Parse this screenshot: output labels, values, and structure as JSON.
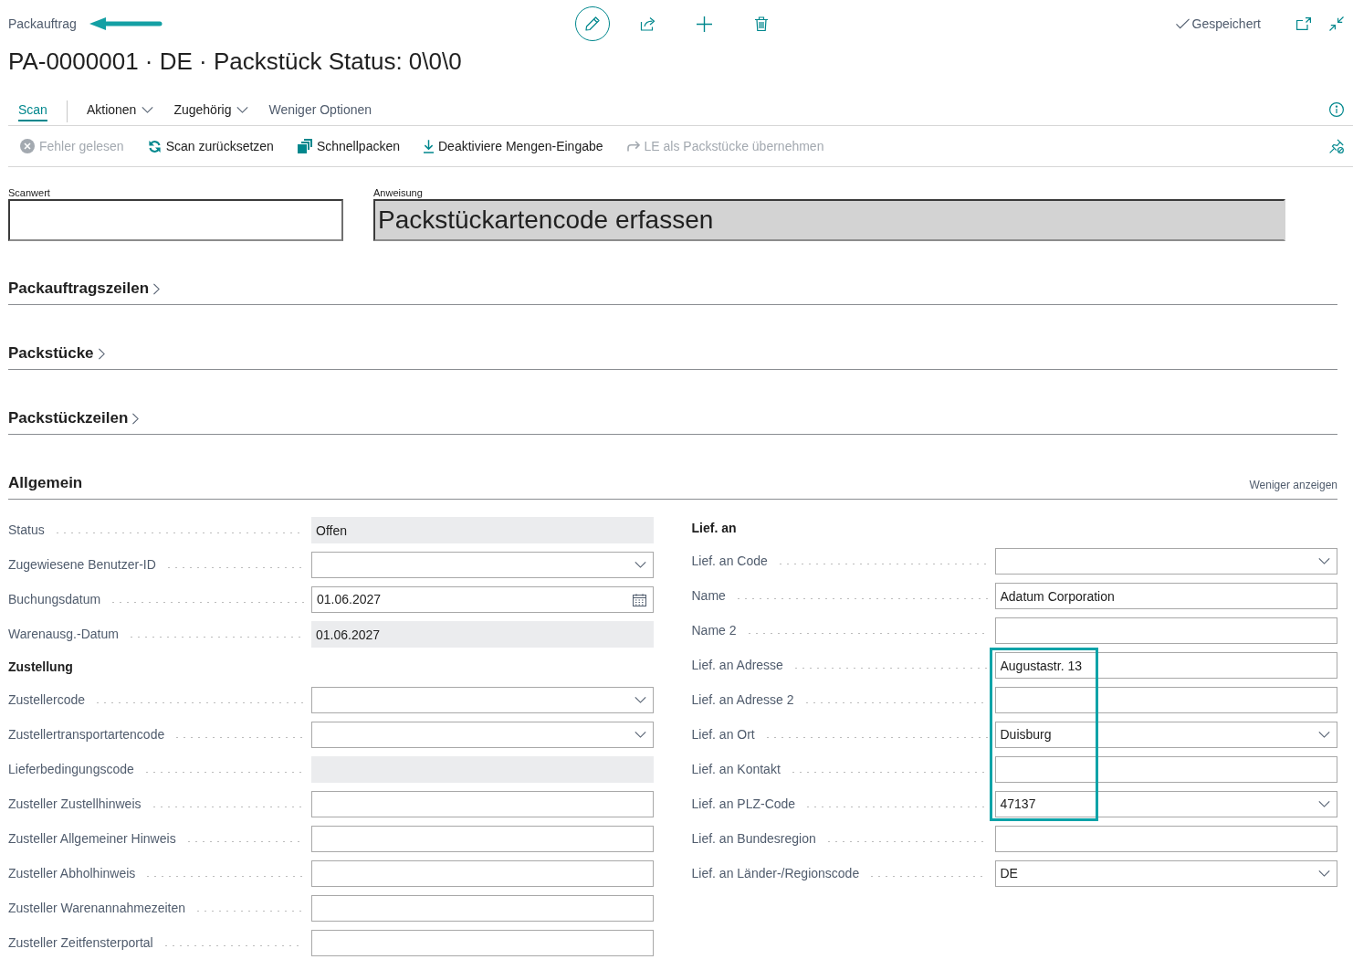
{
  "header": {
    "breadcrumb": "Packauftrag",
    "breadcrumb_marked": true,
    "save_status": "Gespeichert",
    "title": "PA-0000001 · DE · Packstück Status: 0\\0\\0"
  },
  "tabs": [
    {
      "kind": "tab",
      "label": "Scan",
      "selected": true
    },
    {
      "kind": "menu",
      "label": "Aktionen",
      "selected": false
    },
    {
      "kind": "menu",
      "label": "Zugehörig",
      "selected": false
    },
    {
      "kind": "toggle",
      "label": "Weniger Optionen",
      "selected": false
    }
  ],
  "actions": [
    {
      "label": "Fehler gelesen",
      "disabled": true
    },
    {
      "label": "Scan zurücksetzen",
      "disabled": false
    },
    {
      "label": "Schnellpacken",
      "disabled": false
    },
    {
      "label": "Deaktiviere Mengen-Eingabe",
      "disabled": false
    },
    {
      "label": "LE als Packstücke übernehmen",
      "disabled": true
    }
  ],
  "scan": {
    "label": "Scanwert"
  },
  "instruction": {
    "label": "Anweisung",
    "value": "Packstückartencode erfassen"
  },
  "sections": [
    {
      "title": "Packauftragszeilen",
      "expanded": false
    },
    {
      "title": "Packstücke",
      "expanded": false
    },
    {
      "title": "Packstückzeilen",
      "expanded": false
    },
    {
      "title": "Allgemein",
      "expanded": true,
      "toggle": "Weniger anzeigen",
      "left": [
        {
          "kind": "readonly",
          "label": "Status",
          "value": "Offen"
        },
        {
          "kind": "dropdown",
          "label": "Zugewiesene Benutzer-ID"
        },
        {
          "kind": "date",
          "label": "Buchungsdatum",
          "value": "01.06.2027"
        },
        {
          "kind": "readonly",
          "label": "Warenausg.-Datum",
          "value": "01.06.2027"
        },
        {
          "kind": "group",
          "label": "Zustellung"
        },
        {
          "kind": "dropdown",
          "label": "Zustellercode"
        },
        {
          "kind": "dropdown",
          "label": "Zustellertransportartencode"
        },
        {
          "kind": "readonly",
          "label": "Lieferbedingungscode"
        },
        {
          "kind": "text",
          "label": "Zusteller Zustellhinweis"
        },
        {
          "kind": "text",
          "label": "Zusteller Allgemeiner Hinweis"
        },
        {
          "kind": "text",
          "label": "Zusteller Abholhinweis"
        },
        {
          "kind": "text",
          "label": "Zusteller Warenannahmezeiten"
        },
        {
          "kind": "text",
          "label": "Zusteller Zeitfensterportal"
        }
      ],
      "right": [
        {
          "kind": "group",
          "label": "Lief. an",
          "highlighted": false
        },
        {
          "kind": "dropdown",
          "label": "Lief. an Code",
          "highlighted": false
        },
        {
          "kind": "text",
          "label": "Name",
          "value": "Adatum Corporation",
          "highlighted": false
        },
        {
          "kind": "text",
          "label": "Name 2",
          "highlighted": false
        },
        {
          "kind": "text",
          "label": "Lief. an Adresse",
          "value": "Augustastr. 13",
          "highlighted": true
        },
        {
          "kind": "text",
          "label": "Lief. an Adresse 2",
          "highlighted": true
        },
        {
          "kind": "dropdown",
          "label": "Lief. an Ort",
          "value": "Duisburg",
          "highlighted": true
        },
        {
          "kind": "text",
          "label": "Lief. an Kontakt",
          "highlighted": true
        },
        {
          "kind": "dropdown",
          "label": "Lief. an PLZ-Code",
          "value": "47137",
          "highlighted": true
        },
        {
          "kind": "text",
          "label": "Lief. an Bundesregion",
          "highlighted": false
        },
        {
          "kind": "dropdown",
          "label": "Lief. an Länder-/Regionscode",
          "value": "DE",
          "highlighted": false
        }
      ]
    }
  ]
}
